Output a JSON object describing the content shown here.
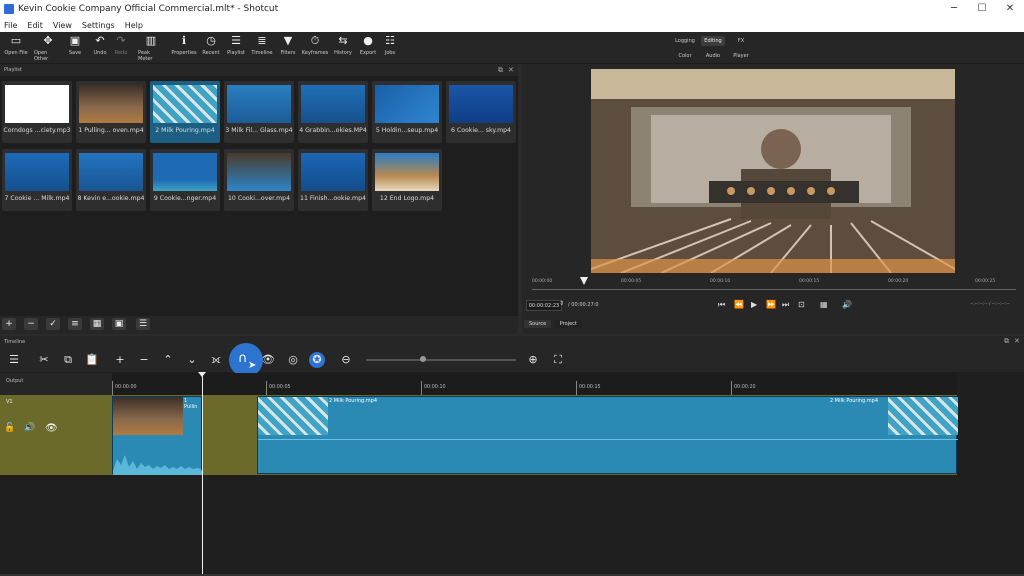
{
  "window": {
    "title": "Kevin Cookie Company Official Commercial.mlt* - Shotcut"
  },
  "menu": [
    "File",
    "Edit",
    "View",
    "Settings",
    "Help"
  ],
  "toolbar": [
    {
      "label": "Open File",
      "icon": "open-file-icon"
    },
    {
      "label": "Open Other",
      "icon": "open-other-icon"
    },
    {
      "label": "Save",
      "icon": "save-icon"
    },
    {
      "label": "Undo",
      "icon": "undo-icon"
    },
    {
      "label": "Redo",
      "icon": "redo-icon"
    },
    {
      "label": "Peak Meter",
      "icon": "peak-meter-icon"
    },
    {
      "label": "Properties",
      "icon": "properties-icon"
    },
    {
      "label": "Recent",
      "icon": "recent-icon"
    },
    {
      "label": "Playlist",
      "icon": "playlist-icon"
    },
    {
      "label": "Timeline",
      "icon": "timeline-icon"
    },
    {
      "label": "Filters",
      "icon": "filters-icon"
    },
    {
      "label": "Keyframes",
      "icon": "keyframes-icon"
    },
    {
      "label": "History",
      "icon": "history-icon"
    },
    {
      "label": "Export",
      "icon": "export-icon"
    },
    {
      "label": "Jobs",
      "icon": "jobs-icon"
    }
  ],
  "layouts": {
    "row1": [
      "Logging",
      "Editing",
      "FX"
    ],
    "row2": [
      "Color",
      "Audio",
      "Player"
    ],
    "active": "Editing"
  },
  "playlist": {
    "title": "Playlist",
    "items": [
      "Corndogs ...ciety.mp3",
      "1 Pulling... oven.mp4",
      "2 Milk Pouring.mp4",
      "3 Milk Fil... Glass.mp4",
      "4 Grabbin...okies.MP4",
      "5 Holdin...seup.mp4",
      "6 Cookie... sky.mp4",
      "7 Cookie ... Milk.mp4",
      "8 Kevin e...ookie.mp4",
      "9 Cookie...nger.mp4",
      "10 Cooki...over.mp4",
      "11 Finish...ookie.mp4",
      "12 End Logo.mp4"
    ],
    "selected_index": 2
  },
  "viewer": {
    "timecode": "00:00:02:23",
    "duration": "/ 00:00:27:0",
    "ruler": [
      "00:00:00",
      "00:00:05",
      "00:00:10",
      "00:00:15",
      "00:00:20",
      "00:00:25"
    ],
    "tabs": [
      "Source",
      "Project"
    ],
    "dashes": "--:--:--:-- / --:--:--:--"
  },
  "timeline": {
    "title": "Timeline",
    "output_label": "Output",
    "track_label": "V1",
    "ruler": [
      "00:00:00",
      "00:00:05",
      "00:00:10",
      "00:00:15",
      "00:00:20"
    ],
    "clips": {
      "first": "1 Pullin",
      "second_start": "2 Milk Pouring.mp4",
      "second_end": "2 Milk Pouring.mp4"
    }
  }
}
